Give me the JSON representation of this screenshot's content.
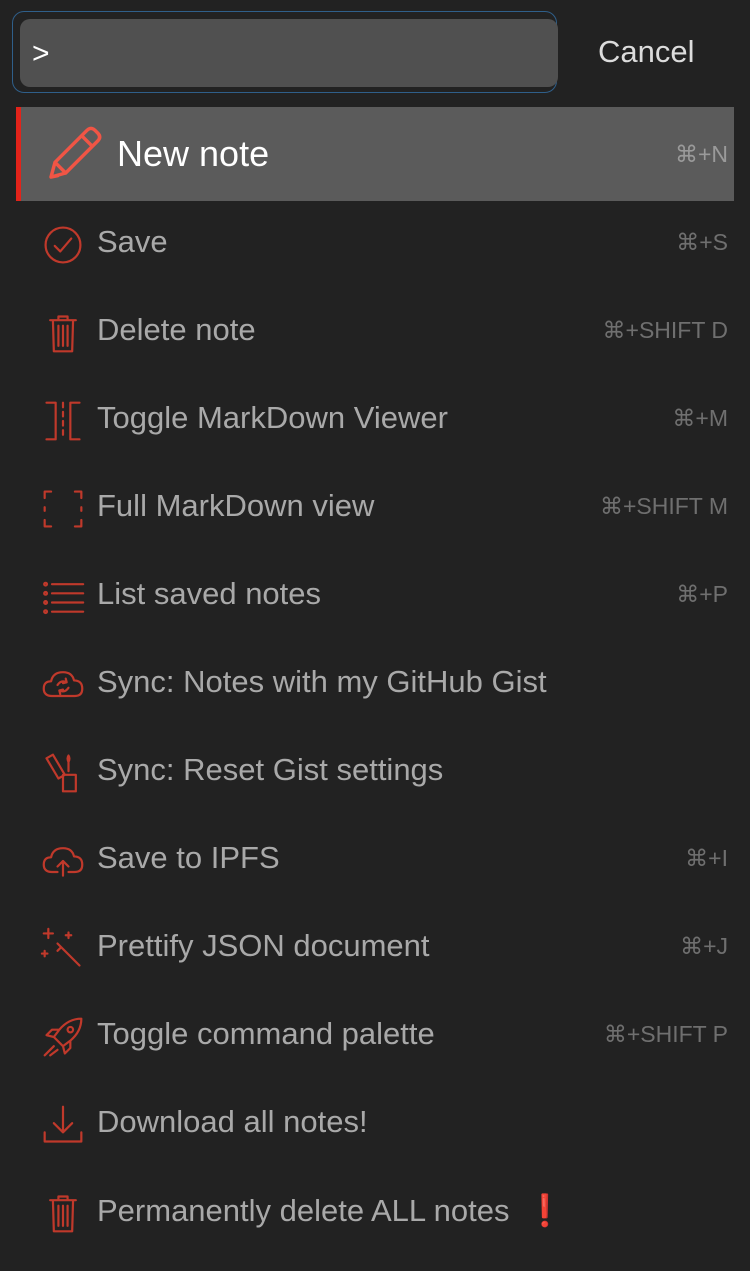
{
  "search": {
    "value": ">",
    "cancel_label": "Cancel"
  },
  "commands": [
    {
      "label": "New note",
      "shortcut": "⌘+N",
      "icon": "pencil-icon",
      "selected": true
    },
    {
      "label": "Save",
      "shortcut": "⌘+S",
      "icon": "check-circle-icon"
    },
    {
      "label": "Delete note",
      "shortcut": "⌘+SHIFT D",
      "icon": "trash-icon"
    },
    {
      "label": "Toggle MarkDown Viewer",
      "shortcut": "⌘+M",
      "icon": "split-view-icon"
    },
    {
      "label": "Full MarkDown view",
      "shortcut": "⌘+SHIFT M",
      "icon": "fullscreen-icon"
    },
    {
      "label": "List saved notes",
      "shortcut": "⌘+P",
      "icon": "list-icon"
    },
    {
      "label": "Sync: Notes with my GitHub Gist",
      "shortcut": "",
      "icon": "cloud-sync-icon"
    },
    {
      "label": "Sync: Reset Gist settings",
      "shortcut": "",
      "icon": "eraser-icon"
    },
    {
      "label": "Save to IPFS",
      "shortcut": "⌘+I",
      "icon": "cloud-upload-icon"
    },
    {
      "label": "Prettify JSON document",
      "shortcut": "⌘+J",
      "icon": "magic-wand-icon"
    },
    {
      "label": "Toggle command palette",
      "shortcut": "⌘+SHIFT P",
      "icon": "rocket-icon"
    },
    {
      "label": "Download all notes!",
      "shortcut": "",
      "icon": "download-icon"
    },
    {
      "label": "Permanently delete ALL notes",
      "shortcut": "",
      "icon": "trash-icon",
      "alert": "❗"
    }
  ],
  "colors": {
    "background": "#222222",
    "accent": "#e2231a",
    "icon": "#c0392b",
    "selected_bg": "#5b5b5b"
  }
}
